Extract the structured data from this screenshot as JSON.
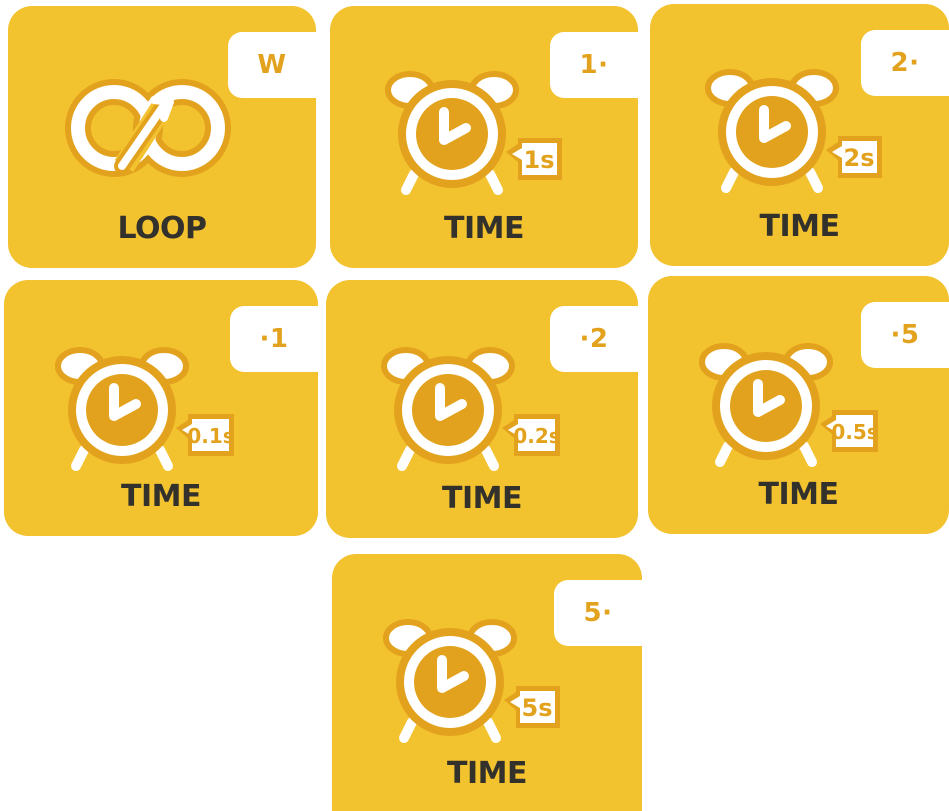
{
  "colors": {
    "card": "#F3C22F",
    "accent": "#E3A21D",
    "label": "#33312B",
    "white": "#FFFFFF"
  },
  "cards": [
    {
      "label": "LOOP",
      "code": "W",
      "icon": "loop-icon"
    },
    {
      "label": "TIME",
      "code": "1·",
      "icon": "alarm-clock-icon",
      "duration": "1s"
    },
    {
      "label": "TIME",
      "code": "2·",
      "icon": "alarm-clock-icon",
      "duration": "2s"
    },
    {
      "label": "TIME",
      "code": "·1",
      "icon": "alarm-clock-icon",
      "duration": "0.1s"
    },
    {
      "label": "TIME",
      "code": "·2",
      "icon": "alarm-clock-icon",
      "duration": "0.2s"
    },
    {
      "label": "TIME",
      "code": "·5",
      "icon": "alarm-clock-icon",
      "duration": "0.5s"
    },
    {
      "label": "TIME",
      "code": "5·",
      "icon": "alarm-clock-icon",
      "duration": "5s"
    }
  ]
}
